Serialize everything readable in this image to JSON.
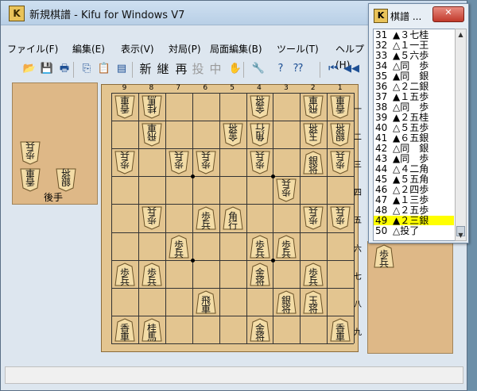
{
  "window": {
    "title": "新規棋譜 - Kifu for Windows V7",
    "icon_letter": "K"
  },
  "menu": [
    "ファイル(F)",
    "編集(E)",
    "表示(V)",
    "対局(P)",
    "局面編集(B)",
    "ツール(T)",
    "ヘルプ(H)"
  ],
  "toolbar": {
    "kanji": [
      "新",
      "継",
      "再",
      "投",
      "中"
    ],
    "symbols": [
      "📂",
      "💾",
      "🖶",
      "⎘",
      "📋",
      "▤",
      "✋",
      "🔧",
      "?",
      "⁇",
      "⏮",
      "◀◀"
    ]
  },
  "board": {
    "file_labels": [
      "9",
      "8",
      "7",
      "6",
      "5",
      "4",
      "3",
      "2",
      "1"
    ],
    "rank_labels": [
      "一",
      "二",
      "三",
      "四",
      "五",
      "六",
      "七",
      "八",
      "九"
    ],
    "pieces": [
      {
        "file": 9,
        "rank": 1,
        "kind": "香",
        "side": "gote"
      },
      {
        "file": 8,
        "rank": 1,
        "kind": "桂",
        "side": "gote"
      },
      {
        "file": 4,
        "rank": 1,
        "kind": "金",
        "side": "gote"
      },
      {
        "file": 2,
        "rank": 1,
        "kind": "飛",
        "side": "gote"
      },
      {
        "file": 1,
        "rank": 1,
        "kind": "香",
        "side": "gote"
      },
      {
        "file": 8,
        "rank": 2,
        "kind": "飛",
        "side": "gote"
      },
      {
        "file": 5,
        "rank": 2,
        "kind": "金",
        "side": "gote"
      },
      {
        "file": 4,
        "rank": 2,
        "kind": "角",
        "side": "gote"
      },
      {
        "file": 2,
        "rank": 2,
        "kind": "玉",
        "side": "gote"
      },
      {
        "file": 1,
        "rank": 2,
        "kind": "銀",
        "side": "gote"
      },
      {
        "file": 9,
        "rank": 3,
        "kind": "歩",
        "side": "gote"
      },
      {
        "file": 7,
        "rank": 3,
        "kind": "歩",
        "side": "gote"
      },
      {
        "file": 6,
        "rank": 3,
        "kind": "歩",
        "side": "gote"
      },
      {
        "file": 4,
        "rank": 3,
        "kind": "歩",
        "side": "gote"
      },
      {
        "file": 2,
        "rank": 3,
        "kind": "銀",
        "side": "sente"
      },
      {
        "file": 1,
        "rank": 3,
        "kind": "歩",
        "side": "gote"
      },
      {
        "file": 3,
        "rank": 4,
        "kind": "歩",
        "side": "gote"
      },
      {
        "file": 8,
        "rank": 5,
        "kind": "歩",
        "side": "gote"
      },
      {
        "file": 6,
        "rank": 5,
        "kind": "歩",
        "side": "sente"
      },
      {
        "file": 5,
        "rank": 5,
        "kind": "角",
        "side": "sente"
      },
      {
        "file": 2,
        "rank": 5,
        "kind": "歩",
        "side": "gote"
      },
      {
        "file": 1,
        "rank": 5,
        "kind": "歩",
        "side": "gote"
      },
      {
        "file": 7,
        "rank": 6,
        "kind": "歩",
        "side": "sente"
      },
      {
        "file": 4,
        "rank": 6,
        "kind": "歩",
        "side": "sente"
      },
      {
        "file": 3,
        "rank": 6,
        "kind": "歩",
        "side": "sente"
      },
      {
        "file": 9,
        "rank": 7,
        "kind": "歩",
        "side": "sente"
      },
      {
        "file": 8,
        "rank": 7,
        "kind": "歩",
        "side": "sente"
      },
      {
        "file": 4,
        "rank": 7,
        "kind": "金",
        "side": "sente"
      },
      {
        "file": 2,
        "rank": 7,
        "kind": "歩",
        "side": "sente"
      },
      {
        "file": 6,
        "rank": 8,
        "kind": "飛",
        "side": "sente"
      },
      {
        "file": 3,
        "rank": 8,
        "kind": "銀",
        "side": "sente"
      },
      {
        "file": 2,
        "rank": 8,
        "kind": "玉",
        "side": "sente"
      },
      {
        "file": 9,
        "rank": 9,
        "kind": "香",
        "side": "sente"
      },
      {
        "file": 8,
        "rank": 9,
        "kind": "桂",
        "side": "sente"
      },
      {
        "file": 4,
        "rank": 9,
        "kind": "金",
        "side": "sente"
      },
      {
        "file": 1,
        "rank": 9,
        "kind": "香",
        "side": "sente"
      }
    ]
  },
  "hands": {
    "gote_label": "後手",
    "gote": [
      {
        "kind": "歩"
      },
      {
        "kind": "香"
      },
      {
        "kind": "銀"
      }
    ],
    "sente": [
      {
        "kind": "歩"
      }
    ]
  },
  "kifu": {
    "title": "棋譜 ...",
    "icon_letter": "K",
    "close_label": "✕",
    "selected": 49,
    "moves": [
      {
        "num": "31",
        "text": "▲３七桂"
      },
      {
        "num": "32",
        "text": "△１一王"
      },
      {
        "num": "33",
        "text": "▲５六歩"
      },
      {
        "num": "34",
        "text": "△同　歩"
      },
      {
        "num": "35",
        "text": "▲同　銀"
      },
      {
        "num": "36",
        "text": "△２二銀"
      },
      {
        "num": "37",
        "text": "▲１五歩"
      },
      {
        "num": "38",
        "text": "△同　歩"
      },
      {
        "num": "39",
        "text": "▲２五桂"
      },
      {
        "num": "40",
        "text": "△５五歩"
      },
      {
        "num": "41",
        "text": "▲６五銀"
      },
      {
        "num": "42",
        "text": "△同　銀"
      },
      {
        "num": "43",
        "text": "▲同　歩"
      },
      {
        "num": "44",
        "text": "△４二角"
      },
      {
        "num": "45",
        "text": "▲５五角"
      },
      {
        "num": "46",
        "text": "△２四歩"
      },
      {
        "num": "47",
        "text": "▲１三歩"
      },
      {
        "num": "48",
        "text": "△２五歩"
      },
      {
        "num": "49",
        "text": "▲２三銀"
      },
      {
        "num": "50",
        "text": "△投了"
      }
    ]
  }
}
